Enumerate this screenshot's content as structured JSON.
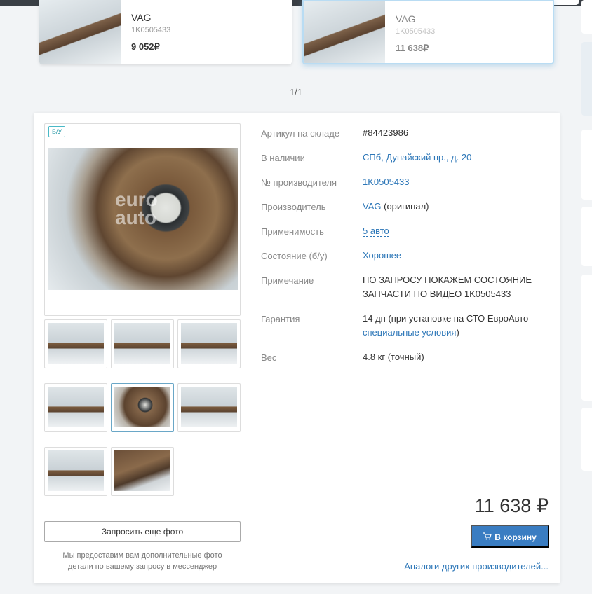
{
  "cards": [
    {
      "brand": "VAG",
      "sku": "1K0505433",
      "price": "9 052₽"
    },
    {
      "brand": "VAG",
      "sku": "1K0505433",
      "price": "11 638₽"
    }
  ],
  "pager": "1/1",
  "product": {
    "badge": "Б/У",
    "watermark": {
      "line1": "euro",
      "line2": "auto"
    },
    "props": {
      "stock_label": "Артикул на складе",
      "stock_value": "#84423986",
      "avail_label": "В наличии",
      "avail_value": "СПб, Дунайский пр., д. 20",
      "mfr_no_label": "№ производителя",
      "mfr_no_value": "1K0505433",
      "maker_label": "Производитель",
      "maker_value": "VAG",
      "maker_note": "(оригинал)",
      "appl_label": "Применимость",
      "appl_value": "5 авто",
      "cond_label": "Состояние (б/у)",
      "cond_value": "Хорошее",
      "note_label": "Примечание",
      "note_value1": "ПО ЗАПРОСУ ПОКАЖЕМ СОСТОЯНИЕ",
      "note_value2": "ЗАПЧАСТИ ПО ВИДЕО 1K0505433",
      "warranty_label": "Гарантия",
      "warranty_value": "14 дн (при установке на СТО ЕвроАвто",
      "warranty_link": "специальные условия",
      "warranty_tail": ")",
      "weight_label": "Вес",
      "weight_value": "4.8 кг (точный)"
    },
    "request_photo_label": "Запросить еще фото",
    "request_note1": "Мы предоставим вам дополнительные фото",
    "request_note2": "детали по вашему запросу в мессенджер",
    "price": "11 638 ₽",
    "cart_label": "В корзину",
    "analogs_label": "Аналоги других производителей..."
  }
}
